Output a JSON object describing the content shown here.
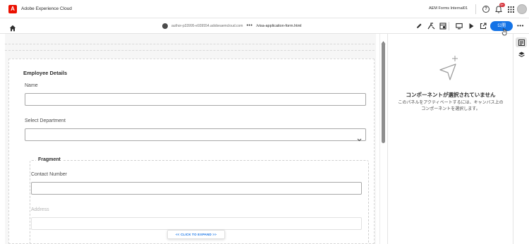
{
  "app": {
    "title": "Adobe Experience Cloud",
    "logo_letter": "A",
    "brand_color": "#eb1000"
  },
  "topbar": {
    "org_name": "AEM Forms Internal01",
    "notification_count": "9+",
    "icons": [
      "help-icon",
      "bell-icon",
      "apps-grid-icon",
      "avatar"
    ]
  },
  "toolbar": {
    "home_icon": "home-icon",
    "url_host": "author-p33995-e939554.adobeaemcloud.com",
    "url_dots": "•••",
    "url_path": "/visa-application-form.html",
    "icons": [
      "edit-icon",
      "rule-editor-icon",
      "page-properties-icon",
      "preview-device-icon",
      "play-preview-icon",
      "share-icon"
    ],
    "publish_label": "公開",
    "publish_color": "#1473e6",
    "more_label": "•••"
  },
  "form": {
    "section_title": "Employee Details",
    "name_label": "Name",
    "name_value": "",
    "department_label": "Select Department",
    "department_value": "",
    "fragment_title": "Fragment",
    "contact_label": "Contact Number",
    "contact_value": "",
    "address_label": "Address",
    "address_value": "",
    "expand_label": "<< CLICK TO EXPAND >>"
  },
  "panel": {
    "empty_title": "コンポーネントが選択されていません",
    "empty_description": "このパネルをアクティベートするには、キャンバス上のコンポーネントを選択します。"
  },
  "rail": {
    "items": [
      "properties-icon",
      "layers-icon"
    ]
  }
}
